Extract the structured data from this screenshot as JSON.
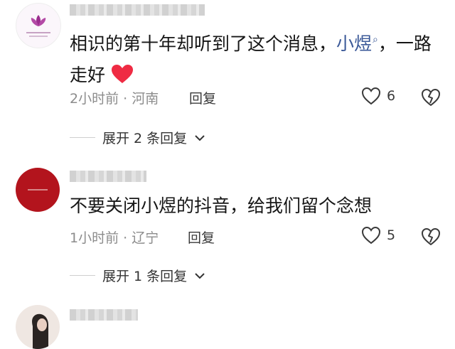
{
  "comments": [
    {
      "text_before": "相识的第十年却听到了这个消息，",
      "mention": "小煜",
      "text_after": "，一路",
      "text_line2": "走好",
      "time": "2小时前",
      "location": "河南",
      "reply_label": "回复",
      "likes": "6",
      "expand_label": "展开 2 条回复"
    },
    {
      "text": "不要关闭小煜的抖音，给我们留个念想",
      "time": "1小时前",
      "location": "辽宁",
      "reply_label": "回复",
      "likes": "5",
      "expand_label": "展开 1 条回复"
    }
  ],
  "colors": {
    "mention": "#3b5998",
    "meta": "#8c8c8c",
    "avatar2_bg": "#b3141d"
  }
}
